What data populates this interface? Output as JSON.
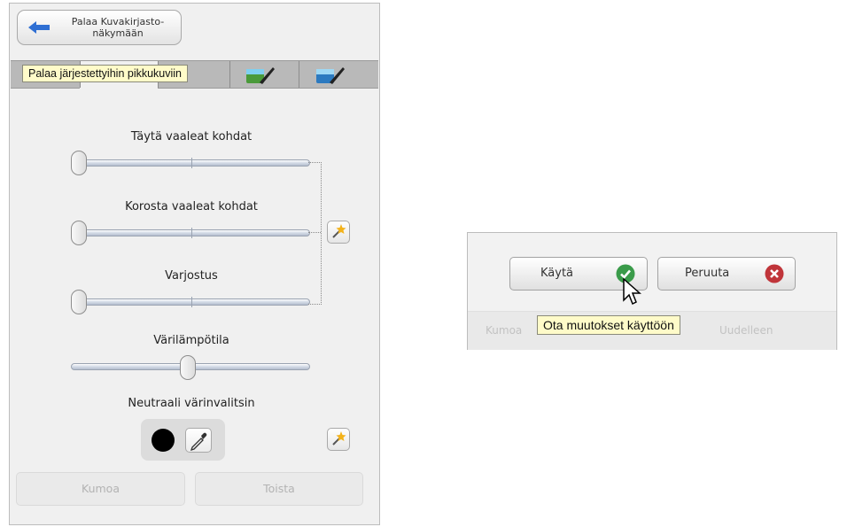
{
  "left_panel": {
    "back_button_label": "Palaa Kuvakirjasto-\nnäkymään",
    "tooltip": "Palaa järjestettyihin pikkukuviin",
    "sliders": {
      "fill_light": {
        "label": "Täytä vaaleat kohdat",
        "value": 0.0
      },
      "highlights": {
        "label": "Korosta vaaleat kohdat",
        "value": 0.0
      },
      "shadows": {
        "label": "Varjostus",
        "value": 0.0
      },
      "temperature": {
        "label": "Värilämpötila",
        "value": 0.5
      }
    },
    "neutral_picker_label": "Neutraali värinvalitsin",
    "neutral_color": "#000000",
    "undo_label": "Kumoa",
    "redo_label": "Toista"
  },
  "right_panel": {
    "apply_label": "Käytä",
    "cancel_label": "Peruuta",
    "tooltip": "Ota muutokset käyttöön",
    "ghost_undo": "Kumoa",
    "ghost_redo": "Uudelleen",
    "apply_color": "#3a9b4a",
    "cancel_color": "#c0353a"
  },
  "icons": [
    "back-arrow-icon",
    "paint-brush-icon",
    "magic-wand-icon",
    "eyedropper-icon",
    "checkmark-icon",
    "x-icon",
    "cursor-icon"
  ]
}
